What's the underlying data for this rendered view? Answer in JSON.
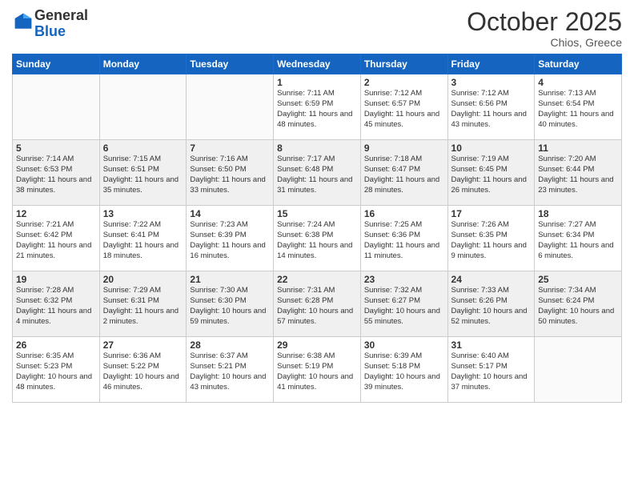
{
  "logo": {
    "general": "General",
    "blue": "Blue"
  },
  "header": {
    "month": "October 2025",
    "location": "Chios, Greece"
  },
  "weekdays": [
    "Sunday",
    "Monday",
    "Tuesday",
    "Wednesday",
    "Thursday",
    "Friday",
    "Saturday"
  ],
  "weeks": [
    [
      {
        "day": "",
        "info": ""
      },
      {
        "day": "",
        "info": ""
      },
      {
        "day": "",
        "info": ""
      },
      {
        "day": "1",
        "info": "Sunrise: 7:11 AM\nSunset: 6:59 PM\nDaylight: 11 hours and 48 minutes."
      },
      {
        "day": "2",
        "info": "Sunrise: 7:12 AM\nSunset: 6:57 PM\nDaylight: 11 hours and 45 minutes."
      },
      {
        "day": "3",
        "info": "Sunrise: 7:12 AM\nSunset: 6:56 PM\nDaylight: 11 hours and 43 minutes."
      },
      {
        "day": "4",
        "info": "Sunrise: 7:13 AM\nSunset: 6:54 PM\nDaylight: 11 hours and 40 minutes."
      }
    ],
    [
      {
        "day": "5",
        "info": "Sunrise: 7:14 AM\nSunset: 6:53 PM\nDaylight: 11 hours and 38 minutes."
      },
      {
        "day": "6",
        "info": "Sunrise: 7:15 AM\nSunset: 6:51 PM\nDaylight: 11 hours and 35 minutes."
      },
      {
        "day": "7",
        "info": "Sunrise: 7:16 AM\nSunset: 6:50 PM\nDaylight: 11 hours and 33 minutes."
      },
      {
        "day": "8",
        "info": "Sunrise: 7:17 AM\nSunset: 6:48 PM\nDaylight: 11 hours and 31 minutes."
      },
      {
        "day": "9",
        "info": "Sunrise: 7:18 AM\nSunset: 6:47 PM\nDaylight: 11 hours and 28 minutes."
      },
      {
        "day": "10",
        "info": "Sunrise: 7:19 AM\nSunset: 6:45 PM\nDaylight: 11 hours and 26 minutes."
      },
      {
        "day": "11",
        "info": "Sunrise: 7:20 AM\nSunset: 6:44 PM\nDaylight: 11 hours and 23 minutes."
      }
    ],
    [
      {
        "day": "12",
        "info": "Sunrise: 7:21 AM\nSunset: 6:42 PM\nDaylight: 11 hours and 21 minutes."
      },
      {
        "day": "13",
        "info": "Sunrise: 7:22 AM\nSunset: 6:41 PM\nDaylight: 11 hours and 18 minutes."
      },
      {
        "day": "14",
        "info": "Sunrise: 7:23 AM\nSunset: 6:39 PM\nDaylight: 11 hours and 16 minutes."
      },
      {
        "day": "15",
        "info": "Sunrise: 7:24 AM\nSunset: 6:38 PM\nDaylight: 11 hours and 14 minutes."
      },
      {
        "day": "16",
        "info": "Sunrise: 7:25 AM\nSunset: 6:36 PM\nDaylight: 11 hours and 11 minutes."
      },
      {
        "day": "17",
        "info": "Sunrise: 7:26 AM\nSunset: 6:35 PM\nDaylight: 11 hours and 9 minutes."
      },
      {
        "day": "18",
        "info": "Sunrise: 7:27 AM\nSunset: 6:34 PM\nDaylight: 11 hours and 6 minutes."
      }
    ],
    [
      {
        "day": "19",
        "info": "Sunrise: 7:28 AM\nSunset: 6:32 PM\nDaylight: 11 hours and 4 minutes."
      },
      {
        "day": "20",
        "info": "Sunrise: 7:29 AM\nSunset: 6:31 PM\nDaylight: 11 hours and 2 minutes."
      },
      {
        "day": "21",
        "info": "Sunrise: 7:30 AM\nSunset: 6:30 PM\nDaylight: 10 hours and 59 minutes."
      },
      {
        "day": "22",
        "info": "Sunrise: 7:31 AM\nSunset: 6:28 PM\nDaylight: 10 hours and 57 minutes."
      },
      {
        "day": "23",
        "info": "Sunrise: 7:32 AM\nSunset: 6:27 PM\nDaylight: 10 hours and 55 minutes."
      },
      {
        "day": "24",
        "info": "Sunrise: 7:33 AM\nSunset: 6:26 PM\nDaylight: 10 hours and 52 minutes."
      },
      {
        "day": "25",
        "info": "Sunrise: 7:34 AM\nSunset: 6:24 PM\nDaylight: 10 hours and 50 minutes."
      }
    ],
    [
      {
        "day": "26",
        "info": "Sunrise: 6:35 AM\nSunset: 5:23 PM\nDaylight: 10 hours and 48 minutes."
      },
      {
        "day": "27",
        "info": "Sunrise: 6:36 AM\nSunset: 5:22 PM\nDaylight: 10 hours and 46 minutes."
      },
      {
        "day": "28",
        "info": "Sunrise: 6:37 AM\nSunset: 5:21 PM\nDaylight: 10 hours and 43 minutes."
      },
      {
        "day": "29",
        "info": "Sunrise: 6:38 AM\nSunset: 5:19 PM\nDaylight: 10 hours and 41 minutes."
      },
      {
        "day": "30",
        "info": "Sunrise: 6:39 AM\nSunset: 5:18 PM\nDaylight: 10 hours and 39 minutes."
      },
      {
        "day": "31",
        "info": "Sunrise: 6:40 AM\nSunset: 5:17 PM\nDaylight: 10 hours and 37 minutes."
      },
      {
        "day": "",
        "info": ""
      }
    ]
  ]
}
